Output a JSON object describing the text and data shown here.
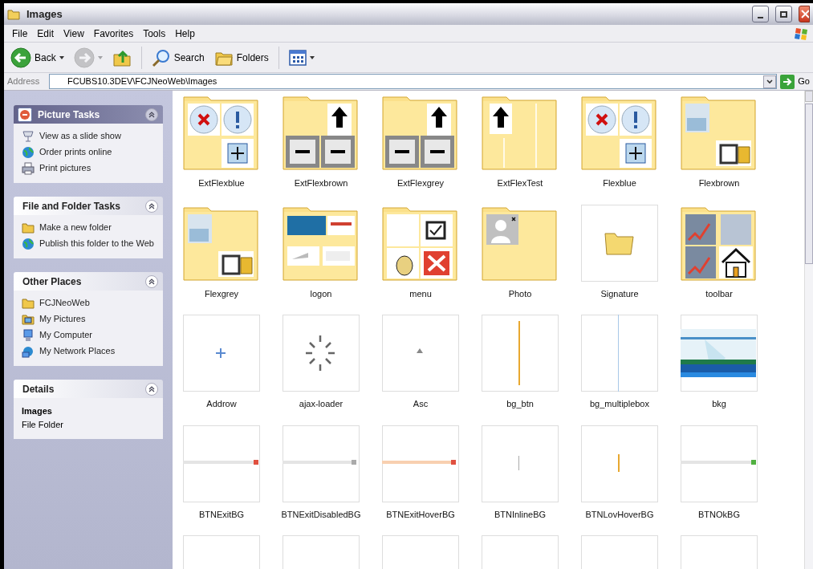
{
  "window": {
    "title": "Images"
  },
  "menu": [
    "File",
    "Edit",
    "View",
    "Favorites",
    "Tools",
    "Help"
  ],
  "toolbar": [
    {
      "kind": "back",
      "label": "Back",
      "disabled": false
    },
    {
      "kind": "forward",
      "disabled": true
    },
    {
      "kind": "up",
      "disabled": false
    },
    {
      "kind": "search",
      "label": "Search",
      "disabled": false
    },
    {
      "kind": "folders",
      "label": "Folders",
      "disabled": false
    },
    {
      "kind": "views",
      "disabled": false
    }
  ],
  "address": {
    "label": "Address",
    "value": "FCUBS10.3DEV\\FCJNeoWeb\\Images",
    "go": "Go"
  },
  "sidebar": [
    {
      "title": "Picture Tasks",
      "kind": "special",
      "items": [
        {
          "label": "View as a slide show",
          "kind": "slideshow"
        },
        {
          "label": "Order prints online",
          "kind": "globe"
        },
        {
          "label": "Print pictures",
          "kind": "printer"
        }
      ]
    },
    {
      "title": "File and Folder Tasks",
      "kind": "tasks",
      "items": [
        {
          "label": "Make a new folder",
          "kind": "folder"
        },
        {
          "label": "Publish this folder to the Web",
          "kind": "globe"
        }
      ]
    },
    {
      "title": "Other Places",
      "kind": "tasks",
      "items": [
        {
          "label": "FCJNeoWeb",
          "kind": "folder"
        },
        {
          "label": "My Pictures",
          "kind": "pictures"
        },
        {
          "label": "My Computer",
          "kind": "computer"
        },
        {
          "label": "My Network Places",
          "kind": "network"
        }
      ]
    },
    {
      "title": "Details",
      "kind": "details",
      "name": "Images",
      "type": "File Folder"
    }
  ],
  "files": [
    {
      "name": "ExtFlexblue",
      "kind": "folder"
    },
    {
      "name": "ExtFlexbrown",
      "kind": "folder"
    },
    {
      "name": "ExtFlexgrey",
      "kind": "folder"
    },
    {
      "name": "ExtFlexTest",
      "kind": "folder"
    },
    {
      "name": "Flexblue",
      "kind": "folder"
    },
    {
      "name": "Flexbrown",
      "kind": "folder"
    },
    {
      "name": "Flexgrey",
      "kind": "folder"
    },
    {
      "name": "logon",
      "kind": "folder"
    },
    {
      "name": "menu",
      "kind": "folder"
    },
    {
      "name": "Photo",
      "kind": "folder"
    },
    {
      "name": "Signature",
      "kind": "empty_folder"
    },
    {
      "name": "toolbar",
      "kind": "folder"
    },
    {
      "name": "Addrow",
      "kind": "image"
    },
    {
      "name": "ajax-loader",
      "kind": "image"
    },
    {
      "name": "Asc",
      "kind": "image"
    },
    {
      "name": "bg_btn",
      "kind": "image"
    },
    {
      "name": "bg_multiplebox",
      "kind": "image"
    },
    {
      "name": "bkg",
      "kind": "image"
    },
    {
      "name": "BTNExitBG",
      "kind": "image"
    },
    {
      "name": "BTNExitDisabledBG",
      "kind": "image"
    },
    {
      "name": "BTNExitHoverBG",
      "kind": "image"
    },
    {
      "name": "BTNInlineBG",
      "kind": "image"
    },
    {
      "name": "BTNLovHoverBG",
      "kind": "image"
    },
    {
      "name": "BTNOkBG",
      "kind": "image"
    },
    {
      "kind": "image"
    },
    {
      "kind": "image"
    },
    {
      "kind": "image"
    },
    {
      "kind": "image"
    },
    {
      "kind": "image"
    },
    {
      "kind": "image"
    }
  ]
}
